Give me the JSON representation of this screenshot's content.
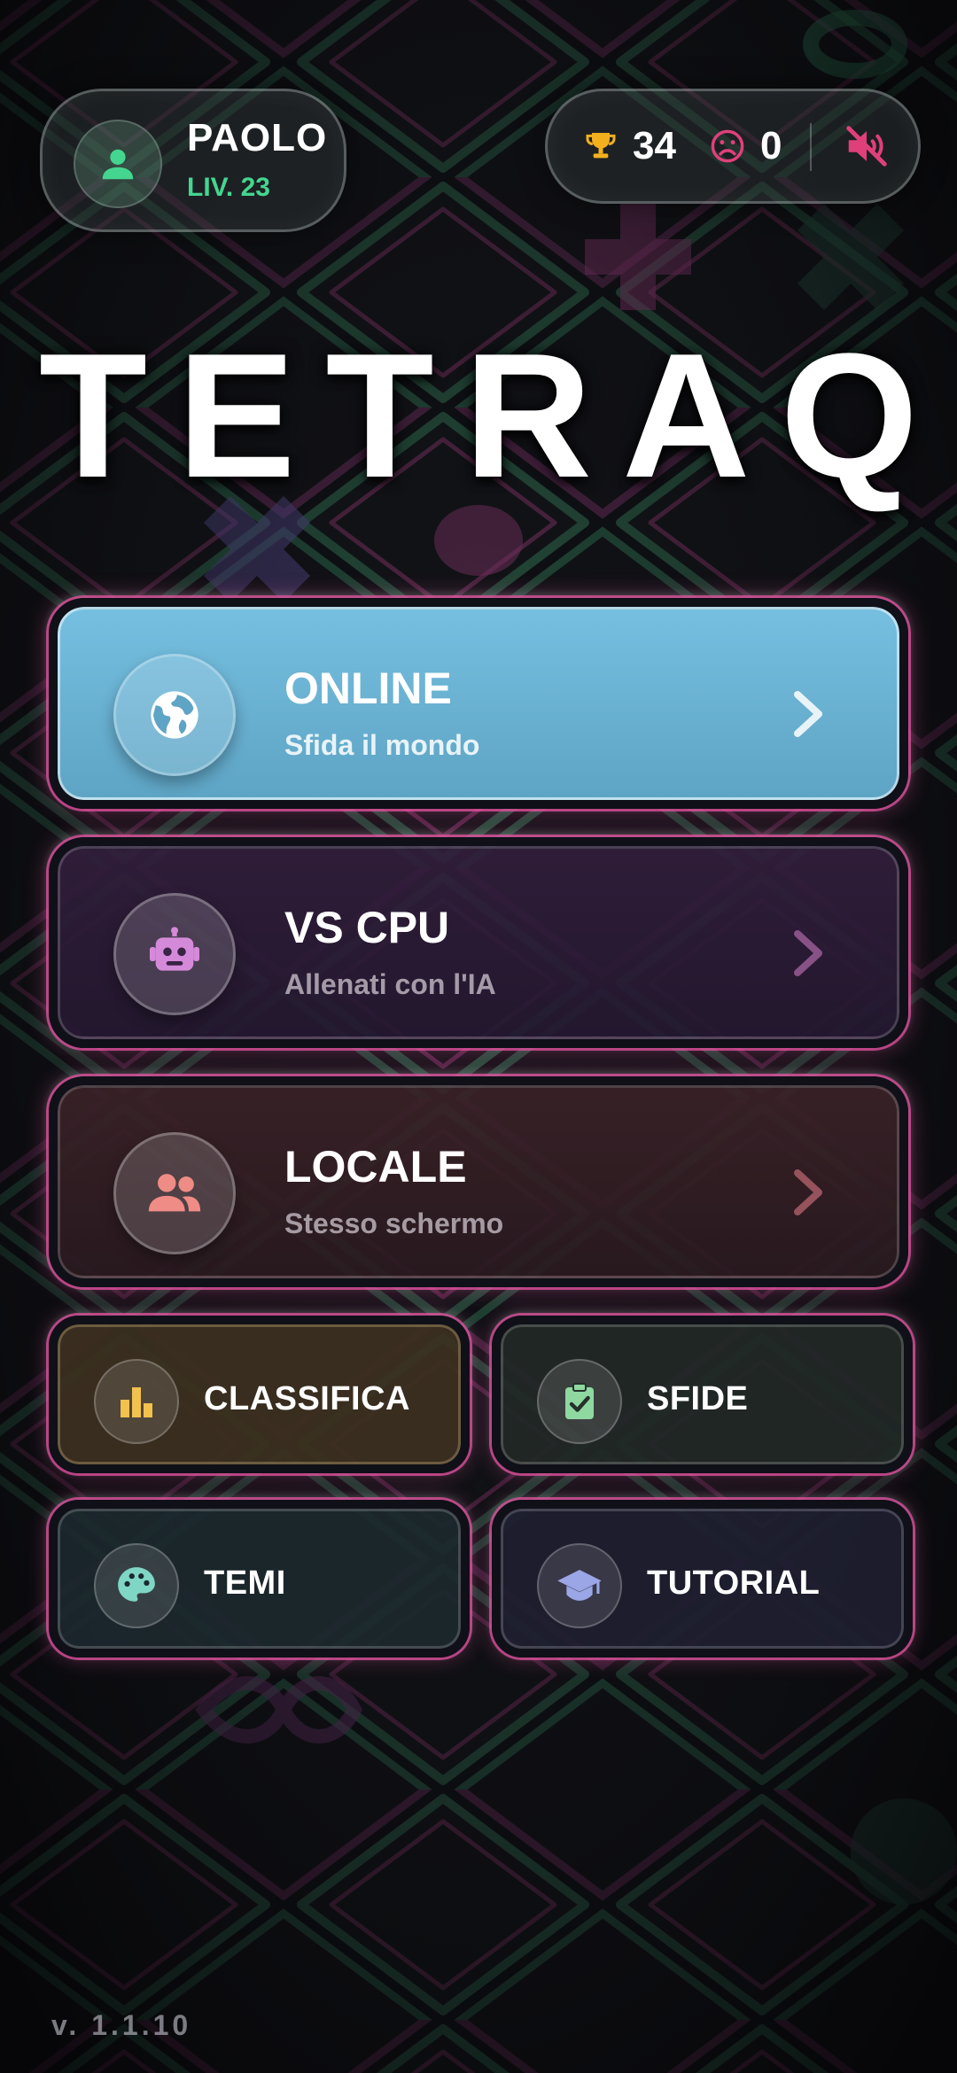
{
  "player": {
    "name": "PAOLO",
    "level": "LIV. 23",
    "avatar_icon": "person-icon"
  },
  "stats": {
    "wins": "34",
    "wins_icon": "trophy-icon",
    "losses": "0",
    "losses_icon": "sad-face-icon",
    "sound_icon": "volume-off-icon"
  },
  "title": "TETRAQ",
  "modes": [
    {
      "title": "ONLINE",
      "subtitle": "Sfida il mondo",
      "icon": "globe-icon"
    },
    {
      "title": "VS CPU",
      "subtitle": "Allenati con l'IA",
      "icon": "robot-icon"
    },
    {
      "title": "LOCALE",
      "subtitle": "Stesso schermo",
      "icon": "group-icon"
    }
  ],
  "menu": [
    {
      "label": "CLASSIFICA",
      "icon": "bar-chart-icon"
    },
    {
      "label": "SFIDE",
      "icon": "clipboard-check-icon"
    },
    {
      "label": "TEMI",
      "icon": "palette-icon"
    },
    {
      "label": "TUTORIAL",
      "icon": "graduation-cap-icon"
    }
  ],
  "version": "v. 1.1.10",
  "colors": {
    "accent_pink": "#e0509e",
    "accent_green": "#44d690",
    "online_blue": "#6ab3d5",
    "trophy_gold": "#f2b01e",
    "loss_pink": "#e0407a"
  }
}
